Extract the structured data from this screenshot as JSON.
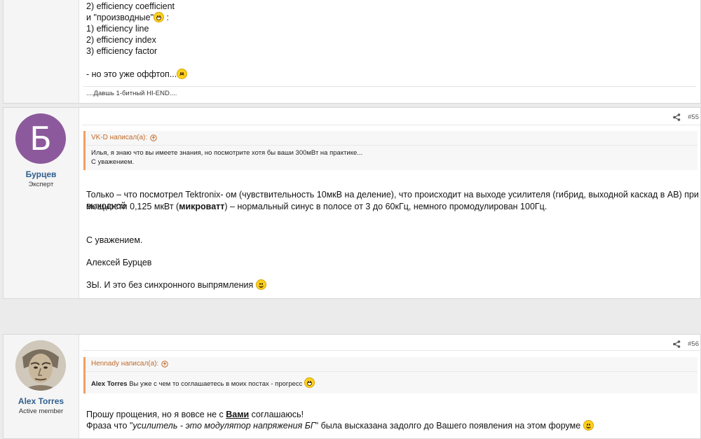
{
  "post1": {
    "lines": [
      "2) efficiency coefficient",
      "и \"производные\"",
      ":",
      "1) efficiency line",
      "2) efficiency index",
      "3) efficiency factor",
      "",
      "- но это уже оффтоп..."
    ],
    "signature": "....Давшь 1-битный HI-END...."
  },
  "post2": {
    "avatar_letter": "Б",
    "avatar_color": "#8c5a9c",
    "username": "Бурцев",
    "user_title": "Эксперт",
    "post_number": "#55",
    "quote_author": "VK-D написал(а):",
    "quote_line1": "Илья, я знаю что вы имеете знания, но посмотрите хотя бы ваши 300мВт на практике...",
    "quote_line2": "С уважением.",
    "text_line1": "Только – что посмотрел Tektronix- ом (чувствительность 10мкВ на деление), что происходит на выходе усилителя (гибрид, выходной каскад в АВ) при выходной",
    "text_line2_a": "мощности 0,125 мкВт (",
    "text_line2_bold": "микроватт",
    "text_line2_b": ") – нормальный синус в полосе от 3 до 60кГц, немного промодулирован 100Гц.",
    "regards": "С уважением.",
    "signature_name": "Алексей Бурцев",
    "ps": "ЗЫ. И это без синхронного выпрямления"
  },
  "post3": {
    "username": "Alex Torres",
    "user_title": "Active member",
    "post_number": "#56",
    "quote_author": "Hennady написал(а):",
    "quote_bold": "Alex Torres",
    "quote_text": " Вы уже с чем то соглашаетесь в моих постах - прогресс",
    "text_line1_a": "Прошу прощения, но я вовсе не с ",
    "text_line1_bold": "Вами",
    "text_line1_b": " соглашаюсь!",
    "text_line2_a": "Фраза что \"",
    "text_line2_italic": "усилитель - это модулятор напряжения БГ",
    "text_line2_b": "\" была высказана задолго до Вашего появления на этом форуме"
  },
  "icons": {
    "share": "share-icon",
    "quote_arrow": "arrow-up-circle-icon",
    "smile": "smile-emoji-icon",
    "grin": "grin-emoji-icon",
    "sad": "sad-emoji-icon"
  },
  "colors": {
    "username": "#2f5e8c",
    "quote_border": "#f0a060",
    "quote_author": "#c06a2a"
  }
}
